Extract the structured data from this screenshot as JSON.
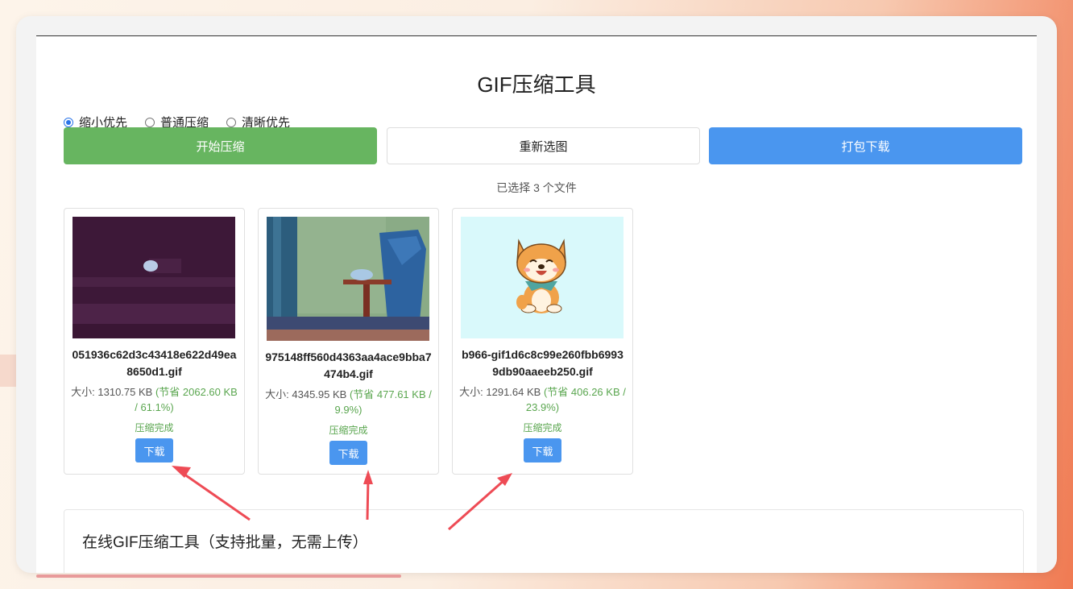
{
  "title": "GIF压缩工具",
  "modes": [
    {
      "label": "缩小优先",
      "checked": true
    },
    {
      "label": "普通压缩",
      "checked": false
    },
    {
      "label": "清晰优先",
      "checked": false
    }
  ],
  "buttons": {
    "start": "开始压缩",
    "reselect": "重新选图",
    "pack": "打包下载"
  },
  "file_count": "已选择 3 个文件",
  "files": [
    {
      "name": "051936c62d3c43418e622d49ea8650d1.gif",
      "size": "大小: 1310.75 KB",
      "saved": "(节省 2062.60 KB / 61.1%)",
      "status": "压缩完成",
      "download": "下载"
    },
    {
      "name": "975148ff560d4363aa4ace9bba7474b4.gif",
      "size": "大小: 4345.95 KB",
      "saved": "(节省 477.61 KB / 9.9%)",
      "status": "压缩完成",
      "download": "下载"
    },
    {
      "name": "b966-gif1d6c8c99e260fbb69939db90aaeeb250.gif",
      "size": "大小: 1291.64 KB",
      "saved": "(节省 406.26 KB / 23.9%)",
      "status": "压缩完成",
      "download": "下载"
    }
  ],
  "info_title": "在线GIF压缩工具（支持批量，无需上传）",
  "colors": {
    "accent_green": "#67b560",
    "accent_blue": "#4a96ef",
    "arrow": "#ee4b55"
  }
}
